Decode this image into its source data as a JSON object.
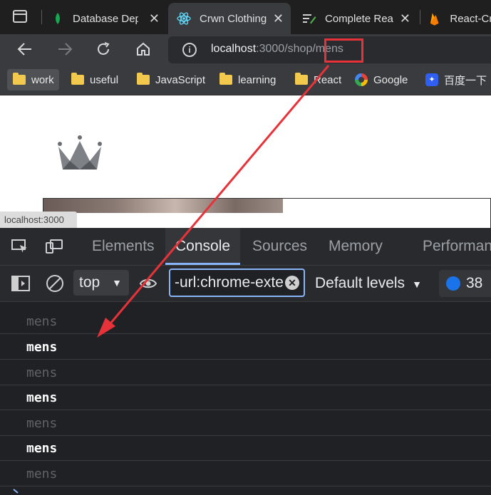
{
  "tabs": [
    {
      "label": "Database Dep",
      "icon": "mongodb-leaf-icon",
      "active": false
    },
    {
      "label": "Crwn Clothing",
      "icon": "react-icon",
      "active": true
    },
    {
      "label": "Complete Rea",
      "icon": "edit-lines-icon",
      "active": false
    },
    {
      "label": "React-Cr",
      "icon": "firebase-icon",
      "active": false
    }
  ],
  "address": {
    "host": "localhost",
    "path": ":3000/shop/",
    "highlighted": "mens"
  },
  "bookmarks": [
    {
      "label": "work",
      "icon": "folder-icon"
    },
    {
      "label": "useful",
      "icon": "folder-icon"
    },
    {
      "label": "JavaScript",
      "icon": "folder-icon"
    },
    {
      "label": "learning",
      "icon": "folder-icon"
    },
    {
      "label": "React",
      "icon": "folder-icon"
    },
    {
      "label": "Google",
      "icon": "google-icon"
    },
    {
      "label": "百度一下",
      "icon": "baidu-icon"
    }
  ],
  "page": {
    "status_url": "localhost:3000"
  },
  "devtools": {
    "tabs": [
      "Elements",
      "Console",
      "Sources",
      "Memory",
      "Performan"
    ],
    "active_tab": "Console",
    "context": "top",
    "filter_value": "-url:chrome-exte",
    "levels": "Default levels",
    "issues_count": "38"
  },
  "console_lines": [
    {
      "text": "mens",
      "style": "dim"
    },
    {
      "text": "mens",
      "style": "bright"
    },
    {
      "text": "mens",
      "style": "dim"
    },
    {
      "text": "mens",
      "style": "bright"
    },
    {
      "text": "mens",
      "style": "dim"
    },
    {
      "text": "mens",
      "style": "bright"
    },
    {
      "text": "mens",
      "style": "dim"
    }
  ],
  "colors": {
    "annotation": "#e8323a",
    "accent": "#8ab4f8"
  }
}
